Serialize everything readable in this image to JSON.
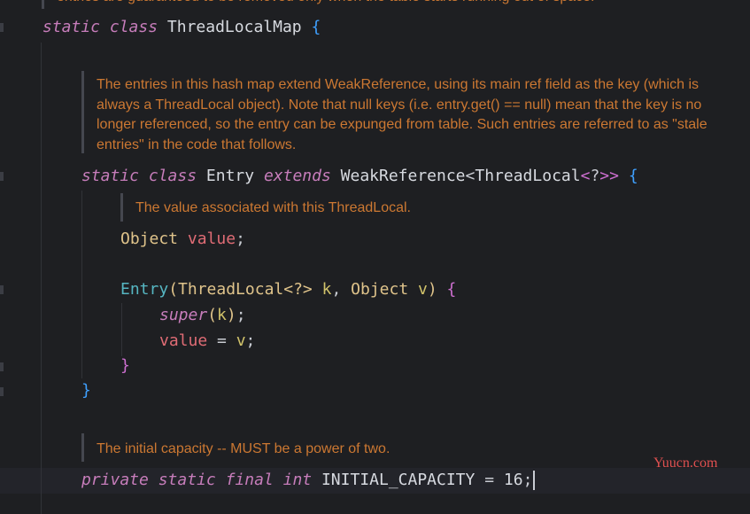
{
  "editor": {
    "top_doc": "entries are guaranteed to be removed only when the table starts running out of space.",
    "map_doc": "The entries in this hash map extend WeakReference, using its main ref field as the key (which is always a ThreadLocal object). Note that null keys (i.e. entry.get() == null) mean that the key is no longer referenced, so the entry can be expunged from table. Such entries are referred to as \"stale entries\" in the code that follows.",
    "entry_doc": "The value associated with this ThreadLocal.",
    "capacity_doc": "The initial capacity -- MUST be a power of two.",
    "code": {
      "kw_static": "static",
      "kw_class": "class",
      "kw_extends": "extends",
      "kw_super": "super",
      "kw_private": "private",
      "kw_final": "final",
      "kw_int": "int",
      "threadlocalmap": "ThreadLocalMap",
      "entry": "Entry",
      "weakref": "WeakReference",
      "threadlocal": "ThreadLocal",
      "generic_q": "<?>",
      "lt": "<",
      "gt_gt": ">>",
      "gt": ">",
      "q": "?",
      "brace_open": "{",
      "brace_close": "}",
      "object": "Object",
      "value": "value",
      "k": "k",
      "v": "v",
      "capacity_const": "INITIAL_CAPACITY",
      "capacity_val": "16"
    }
  },
  "watermark": "Yuucn.com"
}
